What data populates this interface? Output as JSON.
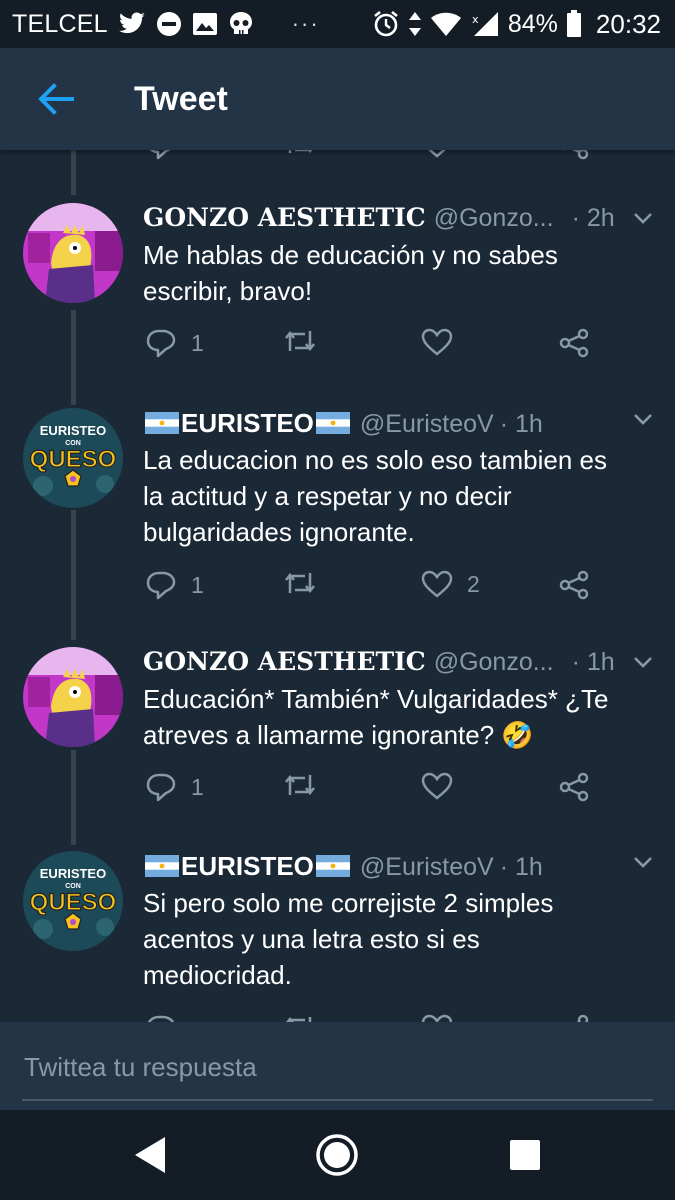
{
  "status_bar": {
    "carrier": "TELCEL",
    "left_icons": [
      "twitter-icon",
      "do-not-disturb-icon",
      "gallery-icon",
      "skull-icon"
    ],
    "dots": "···",
    "battery": "84%",
    "time": "20:32"
  },
  "header": {
    "title": "Tweet"
  },
  "tweets": [
    {
      "name": "GONZO AESTHETIC",
      "handle": "@Gonzo...",
      "time": "· 2h",
      "text": "Me hablas de educación y no sabes escribir, bravo!",
      "replies": "1",
      "retweets": "",
      "likes": ""
    },
    {
      "name": "EURISTEO",
      "handle": "@EuristeoV",
      "time": "· 1h",
      "text": "La educacion no es solo eso tambien es la actitud y a respetar y no decir bulgaridades ignorante.",
      "replies": "1",
      "retweets": "",
      "likes": "2"
    },
    {
      "name": "GONZO AESTHETIC",
      "handle": "@Gonzo...",
      "time": "· 1h",
      "text": "Educación* También* Vulgaridades* ¿Te atreves a llamarme ignorante? 🤣",
      "replies": "1",
      "retweets": "",
      "likes": ""
    },
    {
      "name": "EURISTEO",
      "handle": "@EuristeoV",
      "time": "· 1h",
      "text": "Si pero solo me correjiste 2 simples acentos y una letra esto si es mediocridad.",
      "replies": "",
      "retweets": "",
      "likes": ""
    }
  ],
  "avatar_euristeo": {
    "line1": "EURISTEO",
    "line2": "CON",
    "line3": "QUESO"
  },
  "reply_box": {
    "placeholder": "Twittea tu respuesta"
  },
  "colors": {
    "background": "#1b2836",
    "header": "#243447",
    "accent": "#1da1f2",
    "muted": "#8899a6"
  }
}
